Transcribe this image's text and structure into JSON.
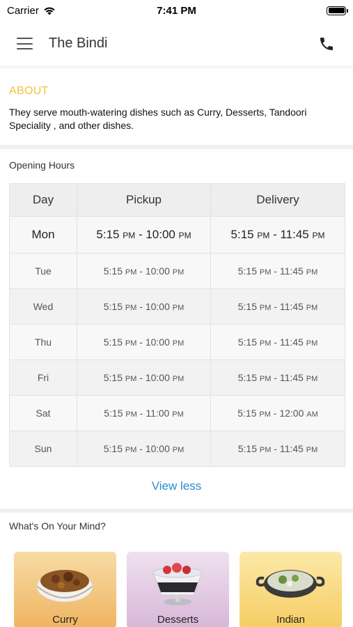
{
  "status_bar": {
    "carrier": "Carrier",
    "time": "7:41 PM"
  },
  "header": {
    "title": "The Bindi",
    "menu_icon": "hamburger-menu-icon",
    "call_icon": "phone-icon"
  },
  "about": {
    "title": "ABOUT",
    "text": "They serve mouth-watering dishes such as Curry, Desserts, Tandoori Speciality , and other dishes."
  },
  "opening_hours": {
    "label": "Opening Hours",
    "columns": [
      "Day",
      "Pickup",
      "Delivery"
    ],
    "today": {
      "day": "Mon",
      "pickup_start": "5:15",
      "pickup_start_ampm": "PM",
      "pickup_end": "10:00",
      "pickup_end_ampm": "PM",
      "delivery_start": "5:15",
      "delivery_start_ampm": "PM",
      "delivery_end": "11:45",
      "delivery_end_ampm": "PM"
    },
    "rows": [
      {
        "day": "Tue",
        "ps": "5:15",
        "psa": "PM",
        "pe": "10:00",
        "pea": "PM",
        "ds": "5:15",
        "dsa": "PM",
        "de": "11:45",
        "dea": "PM"
      },
      {
        "day": "Wed",
        "ps": "5:15",
        "psa": "PM",
        "pe": "10:00",
        "pea": "PM",
        "ds": "5:15",
        "dsa": "PM",
        "de": "11:45",
        "dea": "PM"
      },
      {
        "day": "Thu",
        "ps": "5:15",
        "psa": "PM",
        "pe": "10:00",
        "pea": "PM",
        "ds": "5:15",
        "dsa": "PM",
        "de": "11:45",
        "dea": "PM"
      },
      {
        "day": "Fri",
        "ps": "5:15",
        "psa": "PM",
        "pe": "10:00",
        "pea": "PM",
        "ds": "5:15",
        "dsa": "PM",
        "de": "11:45",
        "dea": "PM"
      },
      {
        "day": "Sat",
        "ps": "5:15",
        "psa": "PM",
        "pe": "11:00",
        "pea": "PM",
        "ds": "5:15",
        "dsa": "PM",
        "de": "12:00",
        "dea": "AM"
      },
      {
        "day": "Sun",
        "ps": "5:15",
        "psa": "PM",
        "pe": "10:00",
        "pea": "PM",
        "ds": "5:15",
        "dsa": "PM",
        "de": "11:45",
        "dea": "PM"
      }
    ],
    "toggle_label": "View less"
  },
  "whats_on_your_mind": {
    "label": "What's On Your Mind?",
    "categories": [
      {
        "label": "Curry"
      },
      {
        "label": "Desserts"
      },
      {
        "label": "Indian"
      }
    ]
  },
  "colors": {
    "about_title": "#f2c23b",
    "link": "#2a8fc7"
  }
}
